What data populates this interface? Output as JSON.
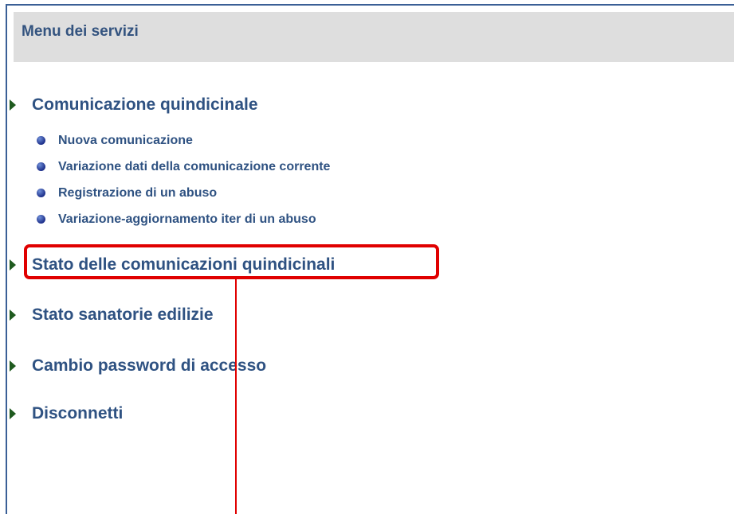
{
  "menu": {
    "title": "Menu dei servizi"
  },
  "sections": {
    "comunicazione": {
      "label": "Comunicazione quindicinale",
      "items": [
        "Nuova comunicazione",
        "Variazione dati della comunicazione corrente",
        "Registrazione di un abuso",
        "Variazione-aggiornamento iter di un abuso"
      ]
    },
    "stato_comunicazioni": {
      "label": "Stato delle comunicazioni quindicinali"
    },
    "stato_sanatorie": {
      "label": "Stato sanatorie edilizie"
    },
    "cambio_password": {
      "label": "Cambio password di accesso"
    },
    "disconnetti": {
      "label": "Disconnetti"
    }
  },
  "colors": {
    "link_text": "#2f5282",
    "arrow": "#1f5a1f",
    "highlight": "#e00000",
    "header_bg": "#dedede"
  }
}
